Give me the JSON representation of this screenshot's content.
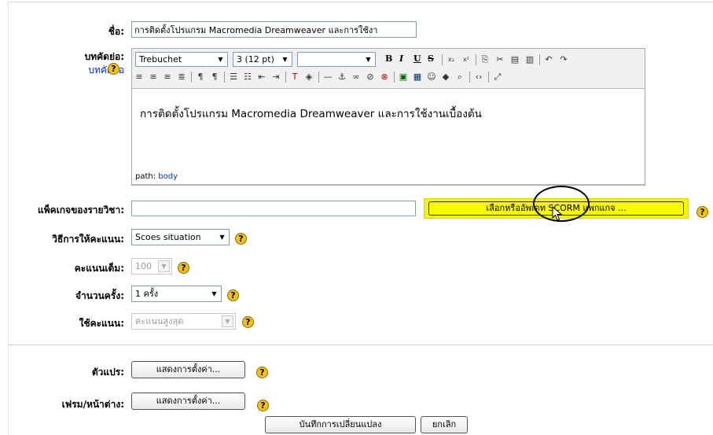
{
  "form": {
    "name_label": "ชื่อ:",
    "name_value": "การติดตั้งโปรแกรม Macromedia Dreamweaver และการใช้งา",
    "summary_label": "บทคัดย่อ:",
    "summary_link": "บทคัดย่อ",
    "editor": {
      "font_name": "Trebuchet",
      "font_size": "3 (12 pt)",
      "heading": "",
      "content": "การติดตั้งโปรแกรม Macromedia Dreamweaver และการใช้งานเบื้องต้น",
      "path_label": "path:",
      "path_value": "body"
    },
    "package_label": "แพ็คเกจของรายวิชา:",
    "package_value": "",
    "package_button": "เลือกหรืออัพเดท SCORM แพกแกจ ...",
    "grading_label": "วิธีการให้คะแนน:",
    "grading_value": "Scoes situation",
    "maxgrade_label": "คะแนนเต็ม:",
    "maxgrade_value": "100",
    "attempts_label": "จำนวนครั้ง:",
    "attempts_value": "1 ครั้ง",
    "whatgrade_label": "ใช้คะแนน:",
    "whatgrade_value": "คะแนนสูงสุด",
    "variables_label": "ตัวแปร:",
    "variables_button": "แสดงการตั้งค่า...",
    "frames_label": "เฟรม/หน้าต่าง:",
    "frames_button": "แสดงการตั้งค่า...",
    "save_button": "บันทึกการเปลี่ยนแปลง",
    "cancel_button": "ยกเลิก",
    "help_glyph": "?"
  },
  "colors": {
    "highlight": "#f6f600",
    "link": "#0033cc",
    "help": "#f4c20d"
  }
}
